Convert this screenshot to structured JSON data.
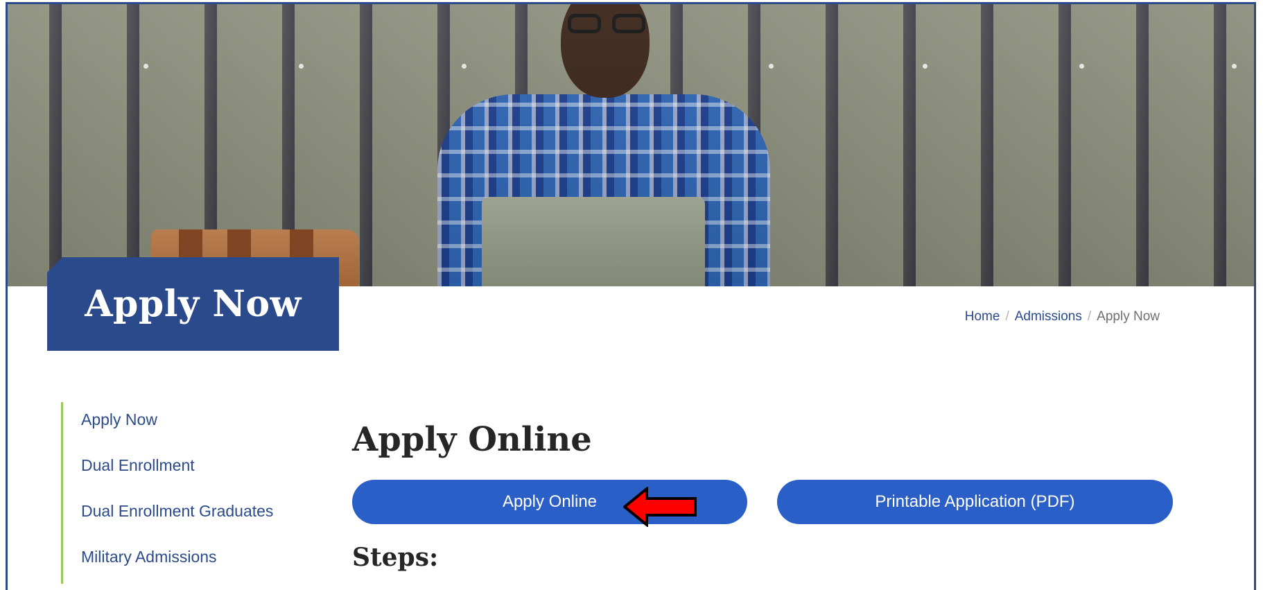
{
  "page": {
    "title": "Apply Now"
  },
  "breadcrumb": {
    "items": [
      "Home",
      "Admissions"
    ],
    "current": "Apply Now",
    "separator": "/"
  },
  "sidebar": {
    "items": [
      {
        "label": "Apply Now"
      },
      {
        "label": "Dual Enrollment"
      },
      {
        "label": "Dual Enrollment Graduates"
      },
      {
        "label": "Military Admissions"
      }
    ]
  },
  "main": {
    "heading": "Apply Online",
    "buttons": {
      "apply_online": "Apply Online",
      "printable_application": "Printable Application (PDF)"
    },
    "steps_heading": "Steps:"
  },
  "annotation": {
    "icon": "red-pointer-arrow-icon",
    "target": "apply-online-button"
  },
  "colors": {
    "brand_navy": "#2b4a8c",
    "button_blue": "#2b5fc8",
    "sidebar_accent": "#9bc75a",
    "annotation_red": "#ff0000"
  }
}
